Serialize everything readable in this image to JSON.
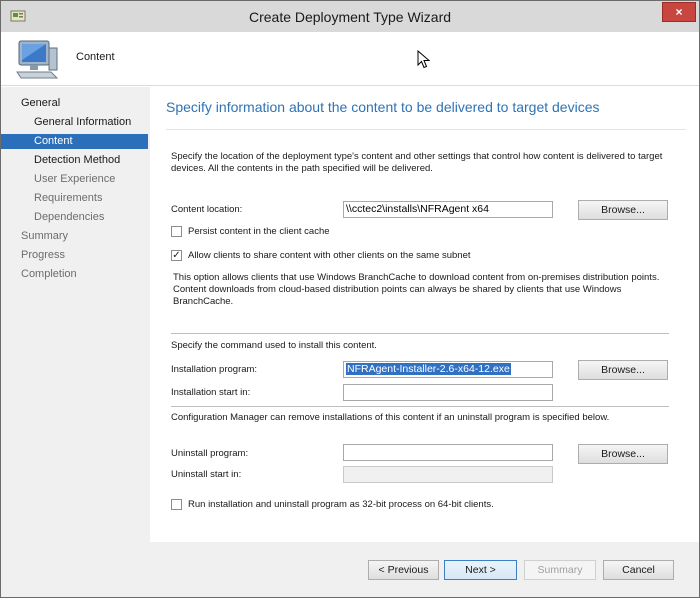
{
  "window": {
    "title": "Create Deployment Type Wizard",
    "close_glyph": "×"
  },
  "header": {
    "title": "Content",
    "icon": "computer-icon"
  },
  "nav": {
    "items": [
      {
        "label": "General",
        "state": "normal"
      },
      {
        "label": "General Information",
        "state": "normal"
      },
      {
        "label": "Content",
        "state": "selected"
      },
      {
        "label": "Detection Method",
        "state": "normal"
      },
      {
        "label": "User Experience",
        "state": "dim"
      },
      {
        "label": "Requirements",
        "state": "dim"
      },
      {
        "label": "Dependencies",
        "state": "dim"
      },
      {
        "label": "Summary",
        "state": "dim"
      },
      {
        "label": "Progress",
        "state": "dim"
      },
      {
        "label": "Completion",
        "state": "dim"
      }
    ]
  },
  "main": {
    "heading": "Specify information about the content to be delivered to target devices",
    "description": "Specify the location of the deployment type's content and other settings that control how content is delivered to target devices. All the contents in the path specified will be delivered.",
    "content_location": {
      "label": "Content location:",
      "value": "\\\\cctec2\\installs\\NFRAgent x64"
    },
    "browse_label": "Browse...",
    "persist": {
      "label": "Persist content in the client cache",
      "checked": false
    },
    "allow_share": {
      "label": "Allow clients to share content with other clients on the same subnet",
      "checked": true
    },
    "branchcache_note": "This option allows clients that use Windows BranchCache to download content from on-premises distribution points. Content downloads from cloud-based distribution points can always be shared by clients that use Windows BranchCache.",
    "install_section_label": "Specify the command used to install this content.",
    "installation_program": {
      "label": "Installation program:",
      "value": "NFRAgent-Installer-2.6-x64-12.exe"
    },
    "installation_start": {
      "label": "Installation start in:",
      "value": ""
    },
    "uninstall_note": "Configuration Manager can remove installations of this content if an uninstall program is specified below.",
    "uninstall_program": {
      "label": "Uninstall program:",
      "value": ""
    },
    "uninstall_start": {
      "label": "Uninstall start in:",
      "value": ""
    },
    "run_32bit": {
      "label": "Run installation and uninstall program as 32-bit process on 64-bit clients.",
      "checked": false
    }
  },
  "footer": {
    "previous": "< Previous",
    "next": "Next >",
    "summary": "Summary",
    "cancel": "Cancel"
  },
  "colors": {
    "accent": "#2b6fba",
    "heading": "#2f73b6",
    "close": "#c7463f"
  }
}
